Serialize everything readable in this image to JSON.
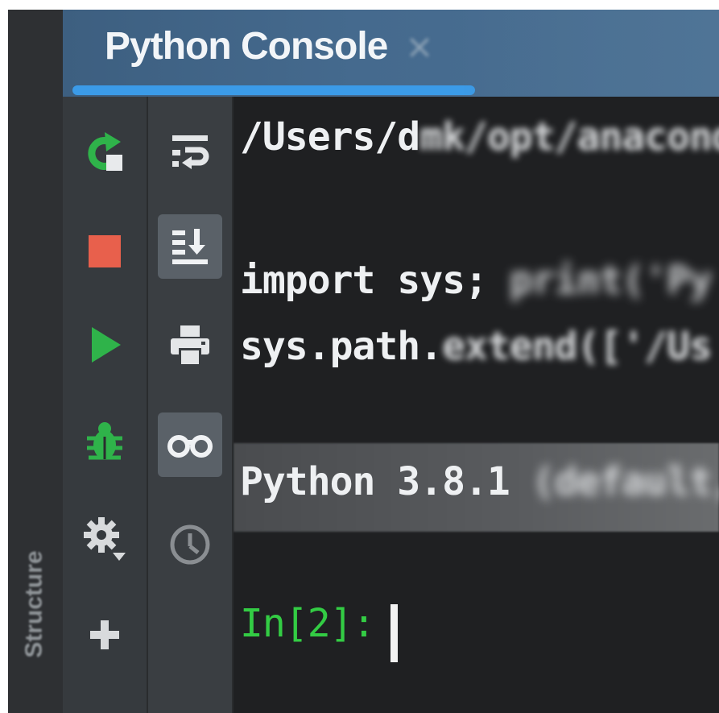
{
  "tab": {
    "title": "Python Console",
    "close_glyph": "×",
    "close_icon": "close-icon"
  },
  "side_panel": {
    "label": "Structure"
  },
  "toolbar_left": {
    "buttons": [
      {
        "name": "rerun-icon",
        "color": "#2fb34a"
      },
      {
        "name": "stop-icon",
        "color": "#e8604c"
      },
      {
        "name": "run-icon",
        "color": "#2fb34a"
      },
      {
        "name": "debug-icon",
        "color": "#2fb34a"
      },
      {
        "name": "settings-gear-icon",
        "color": "#d8dadc"
      },
      {
        "name": "add-icon",
        "color": "#d8dadc"
      }
    ]
  },
  "toolbar_right": {
    "buttons": [
      {
        "name": "soft-wrap-icon",
        "toggled": false
      },
      {
        "name": "scroll-to-end-icon",
        "toggled": true
      },
      {
        "name": "print-icon",
        "toggled": false
      },
      {
        "name": "show-variables-icon",
        "toggled": true
      },
      {
        "name": "history-clock-icon",
        "toggled": false
      }
    ]
  },
  "console": {
    "path_line_sharp": "/Users/d",
    "path_line_blur": "mk/opt/anaconda",
    "import_line_sharp": "import sys; ",
    "import_line_blur": "print('Py",
    "syspath_line_sharp": "sys.path.",
    "syspath_line_blur": "extend(['/Us",
    "version_line_sharp": "Python 3.8.1",
    "version_line_blur": " (default,",
    "prompt": "In[2]:",
    "colors": {
      "background": "#1f2022",
      "text": "#eef0f2",
      "prompt": "#33cc44"
    }
  }
}
